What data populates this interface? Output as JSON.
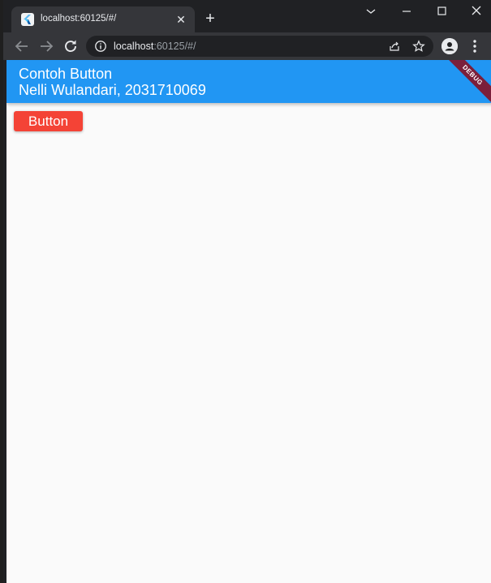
{
  "browser": {
    "tab": {
      "title": "localhost:60125/#/",
      "favicon": "flutter-icon",
      "close_glyph": "✕"
    },
    "new_tab_glyph": "+",
    "address": {
      "host": "localhost",
      "rest": ":60125/#/"
    },
    "window_controls": {
      "dropdown": "⌄",
      "minimize": "—",
      "maximize": "☐",
      "close": "✕"
    },
    "icons": [
      "back-icon",
      "forward-icon",
      "reload-icon",
      "info-icon",
      "share-icon",
      "star-icon",
      "profile-icon",
      "menu-icon"
    ]
  },
  "app": {
    "appbar": {
      "title_line1": "Contoh Button",
      "title_line2": "Nelli Wulandari, 2031710069",
      "color": "#2196f3"
    },
    "debug_banner": "DEBUG",
    "button": {
      "label": "Button",
      "color": "#f44336"
    },
    "background": "#fafafa"
  }
}
